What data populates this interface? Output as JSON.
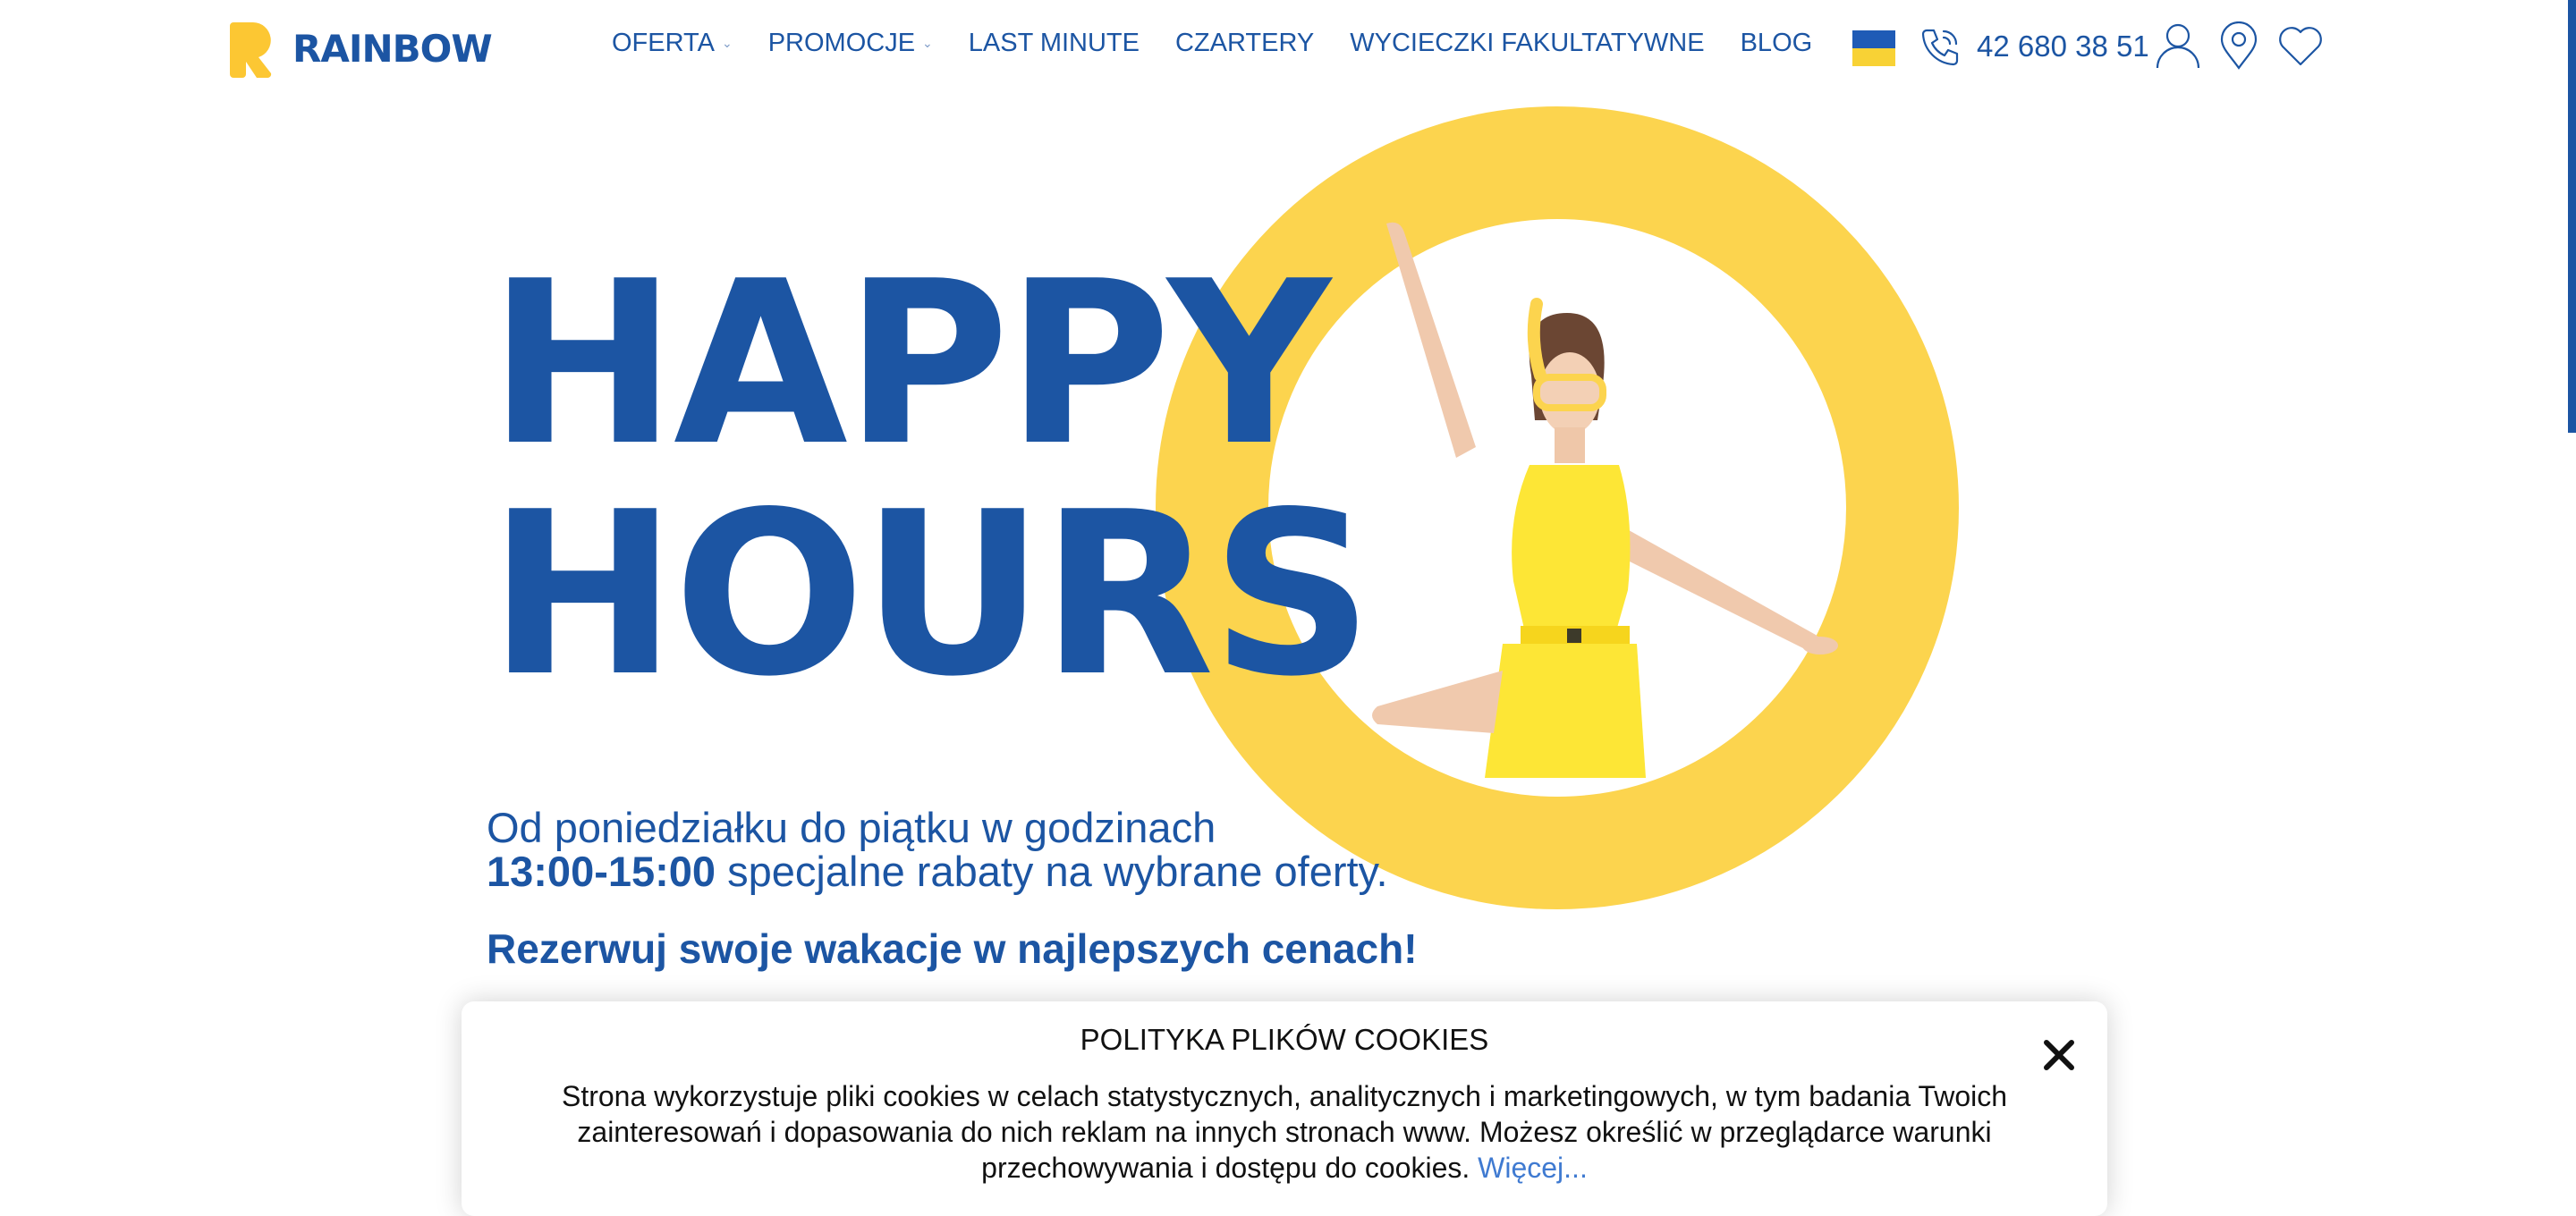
{
  "brand": {
    "name": "RAINBOW",
    "primary_color": "#1c55a3",
    "accent_color": "#fcd44e"
  },
  "nav": [
    {
      "label": "OFERTA",
      "has_dropdown": true
    },
    {
      "label": "PROMOCJE",
      "has_dropdown": true
    },
    {
      "label": "LAST MINUTE",
      "has_dropdown": false
    },
    {
      "label": "CZARTERY",
      "has_dropdown": false
    },
    {
      "label": "WYCIECZKI FAKULTATYWNE",
      "has_dropdown": false
    },
    {
      "label": "BLOG",
      "has_dropdown": false
    }
  ],
  "header": {
    "phone": "42 680 38 51",
    "icons": [
      "ukraine-flag-icon",
      "phone-icon",
      "user-icon",
      "map-pin-icon",
      "heart-icon"
    ]
  },
  "hero": {
    "line1": "HAPPY",
    "line2": "HOURS",
    "subtitle_line1": "Od poniedziałku do piątku w godzinach",
    "subtitle_hours": "13:00-15:00",
    "subtitle_line2_rest": " specjalne rabaty na wybrane oferty.",
    "cta": "Rezerwuj swoje wakacje w najlepszych cenach!"
  },
  "cookie": {
    "title": "POLITYKA PLIKÓW COOKIES",
    "body": "Strona wykorzystuje pliki cookies w celach statystycznych, analitycznych i marketingowych, w tym badania Twoich zainteresowań i dopasowania do nich reklam na innych stronach www. Możesz określić w przeglądarce warunki przechowywania i dostępu do cookies.",
    "more_link": "Więcej..."
  }
}
